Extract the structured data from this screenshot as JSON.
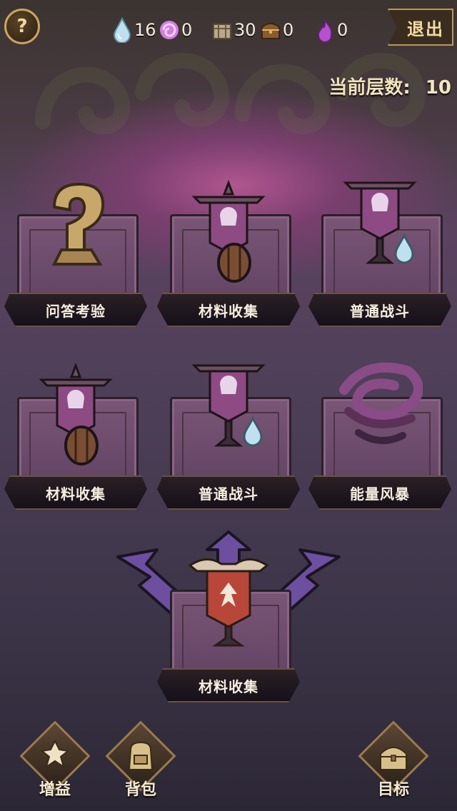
{
  "header": {
    "help_icon": "question-mark-icon",
    "help_glyph": "?",
    "resources": [
      {
        "name": "water-drop-icon",
        "value": "16"
      },
      {
        "name": "purple-swirl-icon",
        "value": "0"
      },
      {
        "name": "crate-icon",
        "value": "30"
      },
      {
        "name": "chest-icon",
        "value": "0"
      },
      {
        "name": "purple-flame-icon",
        "value": "0"
      }
    ],
    "exit_label": "退出",
    "floor_label": "当前层数:",
    "floor_value": "10"
  },
  "map": {
    "row1": [
      {
        "label": "问答考验",
        "icon": "question-statue-icon"
      },
      {
        "label": "材料收集",
        "icon": "banner-shield-icon"
      },
      {
        "label": "普通战斗",
        "icon": "banner-drop-icon"
      }
    ],
    "row2": [
      {
        "label": "材料收集",
        "icon": "banner-shield-icon"
      },
      {
        "label": "普通战斗",
        "icon": "banner-drop-icon"
      },
      {
        "label": "能量风暴",
        "icon": "energy-storm-icon"
      }
    ],
    "current": {
      "label": "材料收集",
      "icon": "red-banner-icon"
    }
  },
  "bottom": {
    "buff_label": "增益",
    "bag_label": "背包",
    "goal_label": "目标"
  },
  "colors": {
    "background_glow": "#b0568f",
    "stone_block": "#6e4b6c",
    "ribbon": "#1c151c",
    "arrow": "#6d4fa0",
    "gold_trim": "#c9a55e"
  }
}
